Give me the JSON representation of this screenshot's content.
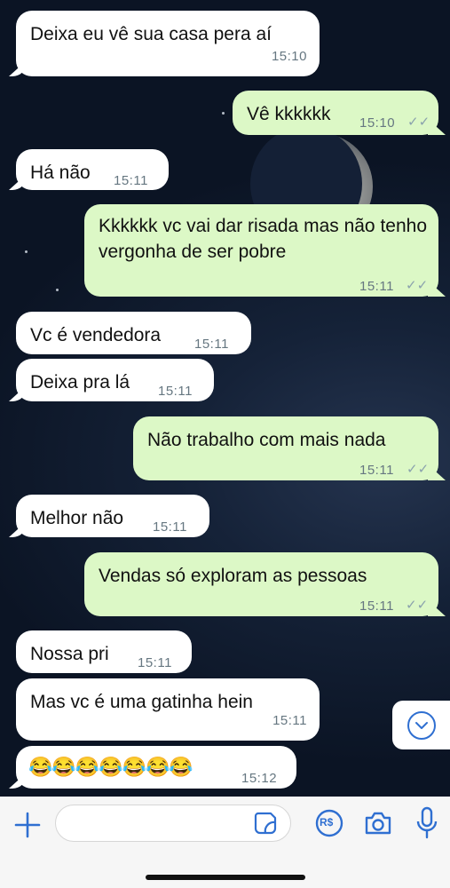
{
  "colors": {
    "incoming_bubble": "#ffffff",
    "outgoing_bubble": "#dcf8c6",
    "timestamp": "#667781",
    "accent": "#2f6fd1"
  },
  "messages": [
    {
      "direction": "incoming",
      "text": "Deixa eu vê sua casa pera aí",
      "time": "15:10"
    },
    {
      "direction": "outgoing",
      "text": "Vê kkkkkk",
      "time": "15:10",
      "status": "read-ticks"
    },
    {
      "direction": "incoming",
      "text": "Há não",
      "time": "15:11"
    },
    {
      "direction": "outgoing",
      "text": "Kkkkkk vc vai dar risada mas não tenho vergonha de ser pobre",
      "time": "15:11",
      "status": "read-ticks"
    },
    {
      "direction": "incoming",
      "text": "Vc é vendedora",
      "time": "15:11"
    },
    {
      "direction": "incoming",
      "text": "Deixa pra lá",
      "time": "15:11"
    },
    {
      "direction": "outgoing",
      "text": "Não trabalho com mais nada",
      "time": "15:11",
      "status": "read-ticks"
    },
    {
      "direction": "incoming",
      "text": "Melhor não",
      "time": "15:11"
    },
    {
      "direction": "outgoing",
      "text": "Vendas só exploram as pessoas",
      "time": "15:11",
      "status": "read-ticks"
    },
    {
      "direction": "incoming",
      "text": "Nossa pri",
      "time": "15:11"
    },
    {
      "direction": "incoming",
      "text": "Mas vc é uma gatinha hein",
      "time": "15:11"
    },
    {
      "direction": "incoming",
      "text": "😂😂😂😂😂😂😂",
      "time": "15:12"
    }
  ],
  "ticks_glyph": "✓✓",
  "composer": {
    "icons": [
      "plus-icon",
      "sticker-icon",
      "payment-icon",
      "camera-icon",
      "microphone-icon"
    ],
    "payment_label": "R$"
  }
}
